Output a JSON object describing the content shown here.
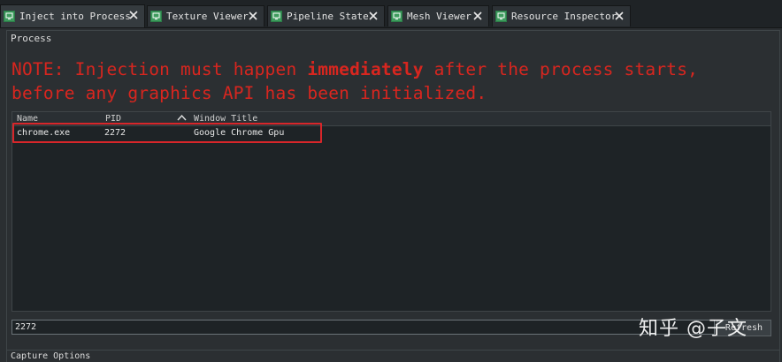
{
  "tabs": [
    {
      "label": "Inject into Process",
      "active": true
    },
    {
      "label": "Texture Viewer",
      "active": false
    },
    {
      "label": "Pipeline State",
      "active": false
    },
    {
      "label": "Mesh Viewer",
      "active": false
    },
    {
      "label": "Resource Inspector",
      "active": false
    }
  ],
  "section": {
    "title": "Process",
    "note_part1": "NOTE: Injection must happen ",
    "note_strong": "immediately",
    "note_part2": " after the process starts,",
    "note_line2": "before any graphics API has been initialized."
  },
  "table": {
    "columns": [
      "Name",
      "PID",
      "Window Title"
    ],
    "sort_indicator": "ascending",
    "rows": [
      {
        "name": "chrome.exe",
        "pid": "2272",
        "title": "Google Chrome Gpu"
      }
    ]
  },
  "pid_input": {
    "value": "2272"
  },
  "refresh_button": {
    "label": "Refresh"
  },
  "watermark": {
    "text": "知乎 @子文"
  },
  "bottom_section": {
    "title": "Capture Options"
  },
  "colors": {
    "note": "#d8261f",
    "tab_icon": "#3d9b5d",
    "highlight": "#d8262a"
  }
}
